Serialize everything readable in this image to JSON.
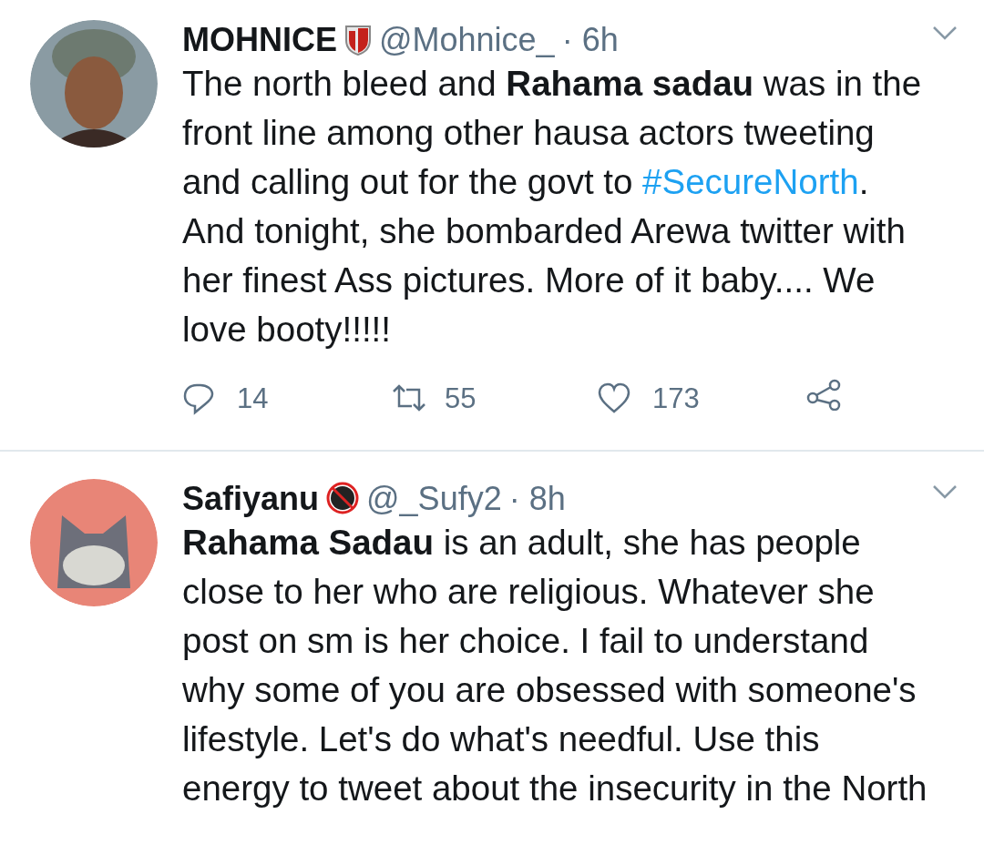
{
  "tweets": [
    {
      "name": "MOHNICE",
      "badge": {
        "kind": "shield"
      },
      "handle": "@Mohnice_",
      "time": "· 6h",
      "body": [
        {
          "kind": "text",
          "text": "The north bleed and **Rahama sadau** was in the front line among other hausa actors tweeting and calling out for the govt to "
        },
        {
          "kind": "hashtag",
          "text": "#SecureNorth"
        },
        {
          "kind": "text",
          "text": ". And tonight, she bombarded Arewa twitter with her finest Ass pictures. More of it baby.... We love booty!!!!!"
        }
      ],
      "replies": "14",
      "retweets": "55",
      "likes": "173"
    },
    {
      "name": "Safiyanu",
      "badge": {
        "kind": "adult"
      },
      "handle": "@_Sufy2",
      "time": "· 8h",
      "body": [
        {
          "kind": "text",
          "text": "**Rahama Sadau** is an adult, she has people close to her who are religious. Whatever she post on sm is her choice. I fail to understand why some of you are obsessed with someone's lifestyle. Let's do what's needful. Use this energy to tweet about the insecurity in the North"
        }
      ]
    }
  ]
}
